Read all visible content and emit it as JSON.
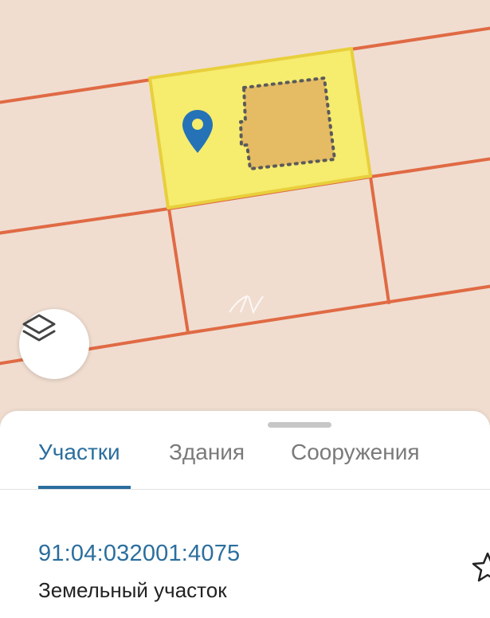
{
  "colors": {
    "map_background": "#f0ddd0",
    "parcel_border": "#e06a44",
    "selected_parcel_fill": "#f6ec6e",
    "selected_parcel_border": "#e8cf3c",
    "building_fill": "#e5bb63",
    "building_outline": "#5a5a5a",
    "marker": "#2573b6",
    "accent": "#2b6e9e"
  },
  "map": {
    "layers_button_icon": "layers-icon",
    "marker_icon": "map-pin-icon"
  },
  "tabs": [
    {
      "label": "Участки",
      "active": true
    },
    {
      "label": "Здания",
      "active": false
    },
    {
      "label": "Сооружения",
      "active": false
    }
  ],
  "result": {
    "cadastral_number": "91:04:032001:4075",
    "type": "Земельный участок",
    "favorite_icon": "star-icon"
  }
}
